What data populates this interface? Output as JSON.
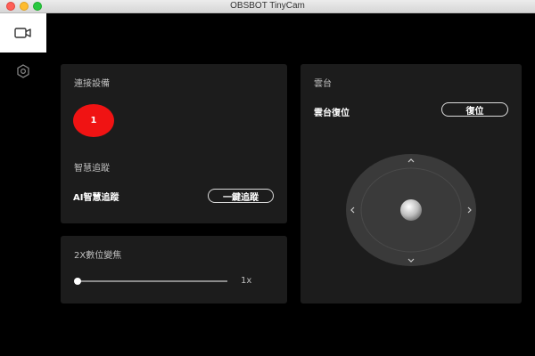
{
  "window": {
    "title": "OBSBOT TinyCam"
  },
  "sidebar": {
    "items": [
      {
        "icon": "camera-icon",
        "active": true
      },
      {
        "icon": "settings-hexagon-icon",
        "active": false
      }
    ]
  },
  "connect_panel": {
    "title": "連接設備",
    "device_number": "1",
    "device_color": "#f01313",
    "tracking_title": "智慧追蹤",
    "ai_tracking_label": "AI智慧追蹤",
    "one_click_button": "一鍵追蹤"
  },
  "zoom_panel": {
    "title": "2X數位變焦",
    "value_label": "1x",
    "slider_fraction": 0.0
  },
  "gimbal_panel": {
    "title": "雲台",
    "reset_label": "雲台復位",
    "reset_button": "復位"
  }
}
